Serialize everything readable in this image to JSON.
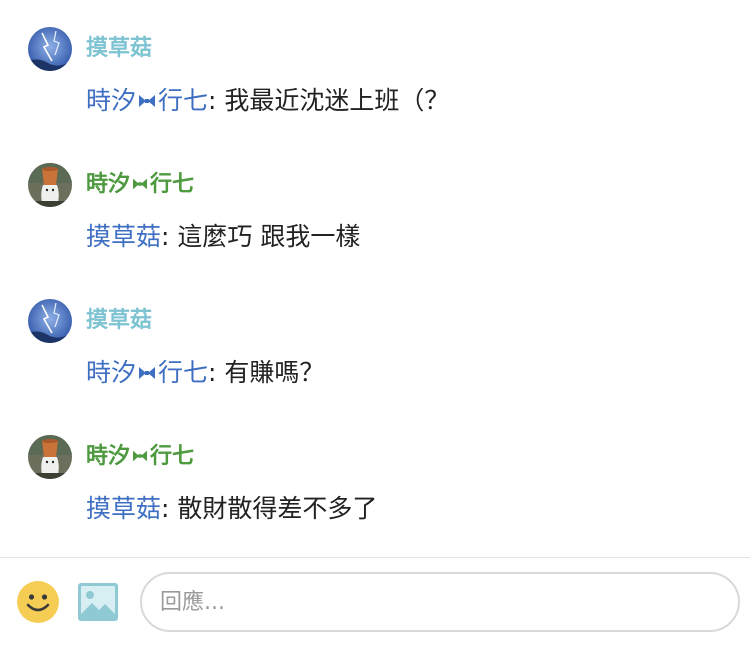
{
  "thread": {
    "messages": [
      {
        "author": "摸草菇",
        "author_variant": "a",
        "mention": "時汐",
        "mention_suffix": "行七",
        "separator": ": ",
        "text": "我最近沈迷上班（？"
      },
      {
        "author_prefix": "時汐",
        "author_suffix": "行七",
        "author_variant": "b",
        "mention": "摸草菇",
        "separator": ": ",
        "text": "這麼巧 跟我一樣"
      },
      {
        "author": "摸草菇",
        "author_variant": "a",
        "mention": "時汐",
        "mention_suffix": "行七",
        "separator": ": ",
        "text": "有賺嗎？"
      },
      {
        "author_prefix": "時汐",
        "author_suffix": "行七",
        "author_variant": "b",
        "mention": "摸草菇",
        "separator": ": ",
        "text": "散財散得差不多了"
      }
    ]
  },
  "composer": {
    "placeholder": "回應...",
    "emoji_icon": "smiley-icon",
    "image_icon": "image-icon"
  },
  "colors": {
    "author_a": "#7ec3d2",
    "author_b": "#4e9a3f",
    "mention": "#3f6fc2",
    "bowtie": "#3f6fc2",
    "emoji_face": "#f5cd54",
    "image_icon": "#8fc9d4"
  }
}
